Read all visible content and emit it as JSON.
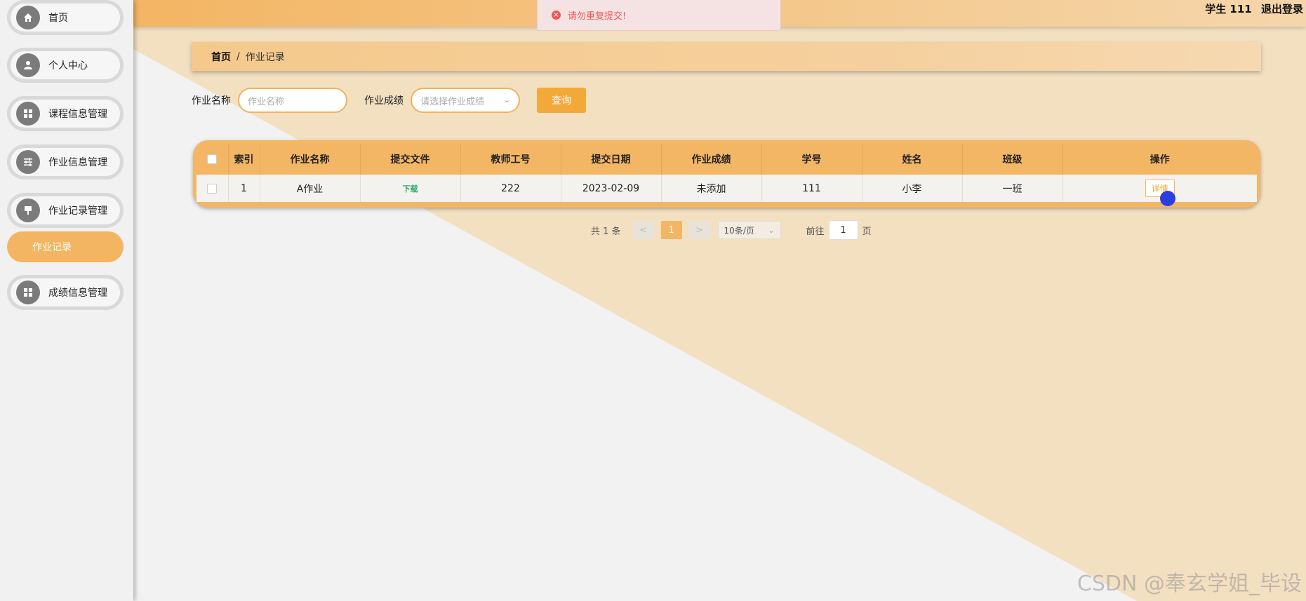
{
  "sidebar": {
    "items": [
      {
        "label": "首页",
        "icon": "home-icon"
      },
      {
        "label": "个人中心",
        "icon": "user-icon"
      },
      {
        "label": "课程信息管理",
        "icon": "grid-icon"
      },
      {
        "label": "作业信息管理",
        "icon": "sliders-icon"
      },
      {
        "label": "作业记录管理",
        "icon": "pin-icon"
      },
      {
        "label": "成绩信息管理",
        "icon": "grid-icon"
      }
    ],
    "submenu": {
      "label": "作业记录"
    }
  },
  "header": {
    "user": "学生 111",
    "logout": "退出登录"
  },
  "toast": {
    "message": "请勿重复提交!"
  },
  "breadcrumb": {
    "home": "首页",
    "separator": "/",
    "current": "作业记录"
  },
  "search": {
    "name_label": "作业名称",
    "name_placeholder": "作业名称",
    "score_label": "作业成绩",
    "score_placeholder": "请选择作业成绩",
    "query_button": "查询"
  },
  "table": {
    "columns": [
      "索引",
      "作业名称",
      "提交文件",
      "教师工号",
      "提交日期",
      "作业成绩",
      "学号",
      "姓名",
      "班级",
      "操作"
    ],
    "rows": [
      {
        "index": "1",
        "name": "A作业",
        "file": "下载",
        "teacher_no": "222",
        "date": "2023-02-09",
        "score": "未添加",
        "student_no": "111",
        "student_name": "小李",
        "class": "一班",
        "action": "详情"
      }
    ]
  },
  "pagination": {
    "total": "共 1 条",
    "prev": "<",
    "page": "1",
    "next": ">",
    "page_size": "10条/页",
    "goto_label": "前往",
    "goto_value": "1",
    "goto_unit": "页"
  },
  "watermark": "CSDN @奉玄学姐_毕设",
  "colors": {
    "accent": "#f3b665",
    "button": "#f3a93a",
    "error": "#f05656",
    "link": "#2aa86b"
  }
}
